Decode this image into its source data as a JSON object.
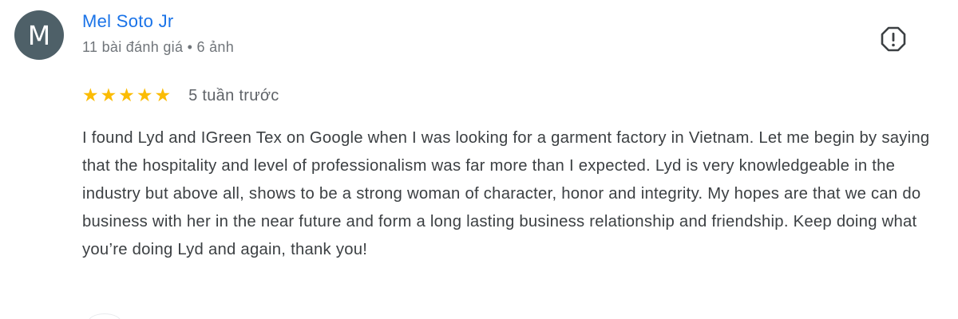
{
  "author": {
    "initial": "M",
    "name": "Mel Soto Jr",
    "meta": "11 bài đánh giá • 6 ảnh"
  },
  "review": {
    "rating": 5,
    "rating_max": 5,
    "date": "5 tuần trước",
    "text": "I found Lyd and IGreen Tex on Google when I was looking for a garment factory in Vietnam. Let me begin by saying that the hospitality and level of professionalism was far more than I expected. Lyd is very knowledgeable in the industry but above all, shows to be a strong woman of character, honor and integrity. My hopes are that we can do business with her in the near future and form a long lasting business relationship and friendship. Keep doing what you’re doing Lyd and again, thank you!"
  },
  "icons": {
    "report": "report-icon",
    "star": "star-icon"
  },
  "colors": {
    "name": "#1a73e8",
    "star": "#fbbc04",
    "avatar_bg": "#4e6068"
  }
}
